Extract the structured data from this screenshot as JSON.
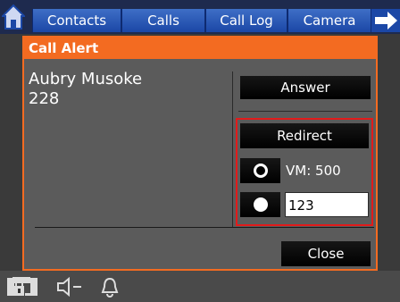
{
  "topbar": {
    "tabs": [
      {
        "label": "Contacts"
      },
      {
        "label": "Calls"
      },
      {
        "label": "Call Log"
      },
      {
        "label": "Camera"
      }
    ],
    "home_icon": "home-icon",
    "next_icon": "arrow-right-icon"
  },
  "dialog": {
    "title": "Call Alert",
    "caller_name": "Aubry Musoke",
    "caller_number": "228",
    "answer_label": "Answer",
    "redirect_label": "Redirect",
    "vm_label": "VM: 500",
    "number_value": "123",
    "close_label": "Close"
  },
  "statusbar": {
    "icons": [
      "phone-lock-icon",
      "speaker-icon",
      "bell-icon"
    ]
  },
  "colors": {
    "accent": "#f36b21",
    "tab": "#2b5cbf",
    "highlight": "#e21b1b"
  }
}
